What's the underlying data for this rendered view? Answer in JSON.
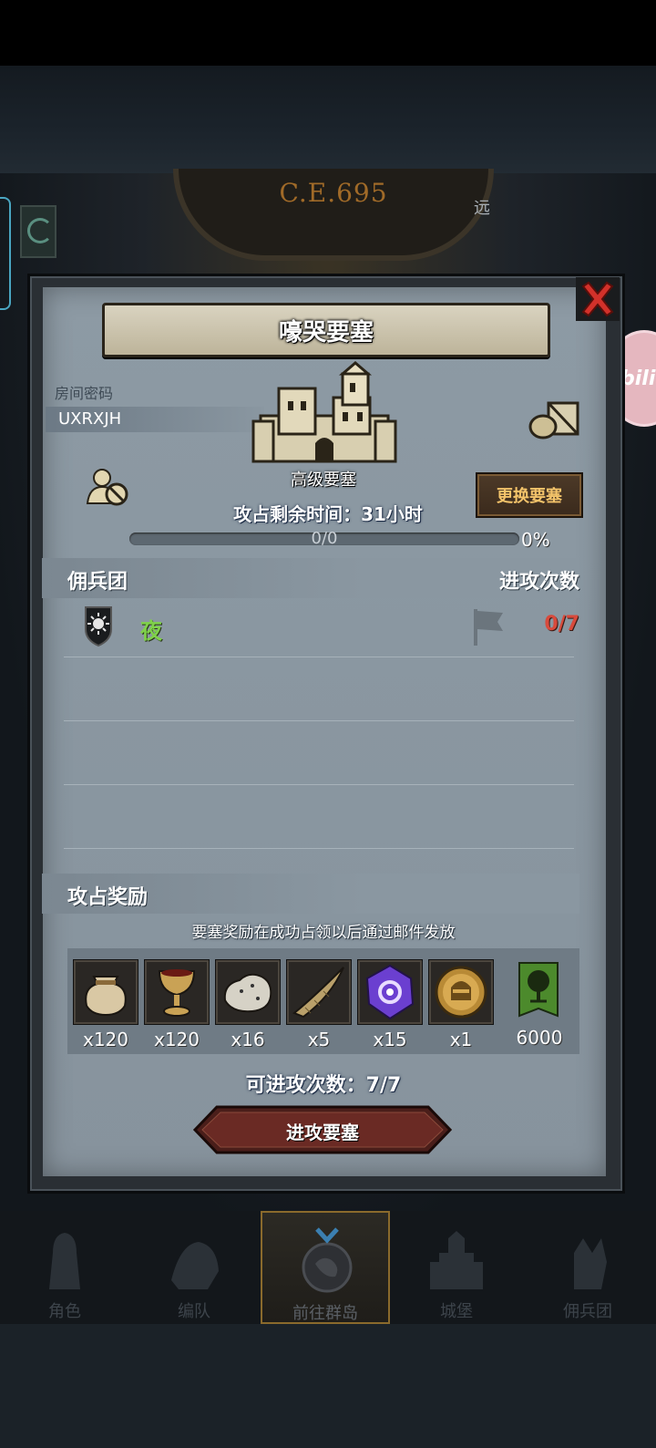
{
  "background": {
    "era_label": "C.E.695",
    "far_label": "远",
    "bili_label": "bili"
  },
  "dialog": {
    "title": "嚎哭要塞",
    "room_label": "房间密码",
    "room_code": "UXRXJH",
    "fortress_grade": "高级要塞",
    "change_button": "更换要塞",
    "time_remaining": "攻占剩余时间：31小时",
    "progress": {
      "text": "0/0",
      "percent_label": "0%",
      "fraction": 0
    },
    "mercenary_header": "佣兵团",
    "attack_count_header": "进攻次数",
    "mercenaries": [
      {
        "name": "夜",
        "attacks": "0/7"
      }
    ],
    "reward_header": "攻占奖励",
    "reward_note": "要塞奖励在成功占领以后通过邮件发放",
    "rewards": [
      {
        "icon": "sack-icon",
        "qty": "x120"
      },
      {
        "icon": "goblet-icon",
        "qty": "x120"
      },
      {
        "icon": "ore-icon",
        "qty": "x16"
      },
      {
        "icon": "horn-icon",
        "qty": "x5"
      },
      {
        "icon": "purple-crystal-icon",
        "qty": "x15"
      },
      {
        "icon": "helmet-medal-icon",
        "qty": "x1"
      },
      {
        "icon": "tree-banner-icon",
        "qty": "6000"
      }
    ],
    "available_attacks": "可进攻次数：7/7",
    "attack_button": "进攻要塞"
  },
  "nav": {
    "items": [
      {
        "label": "角色",
        "icon": "knight-icon"
      },
      {
        "label": "编队",
        "icon": "formation-icon"
      },
      {
        "label": "前往群岛",
        "icon": "globe-icon",
        "active": true
      },
      {
        "label": "城堡",
        "icon": "castle-icon"
      },
      {
        "label": "佣兵团",
        "icon": "mercenary-icon"
      }
    ]
  },
  "colors": {
    "panel": "#8a97a1",
    "merc_name": "#7fd14a",
    "attack_count": "#d84a3c",
    "change_button_text": "#f3c36a"
  }
}
